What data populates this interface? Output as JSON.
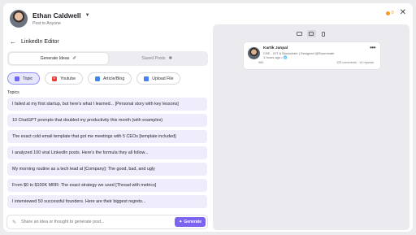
{
  "author": {
    "name": "Ethan Caldwell",
    "visibility": "Post to Anyone"
  },
  "editor": {
    "title": "LinkedIn Editor",
    "back_icon": "arrow-left-icon"
  },
  "tabs": {
    "generate": "Generate Ideas",
    "generate_glyph": "✐",
    "saved": "Saved Posts",
    "saved_glyph": "✱"
  },
  "sources": [
    {
      "label": "Topic",
      "icon": "topic-icon"
    },
    {
      "label": "Youtube",
      "icon": "youtube-icon"
    },
    {
      "label": "Article/Blog",
      "icon": "article-icon"
    },
    {
      "label": "Upload File",
      "icon": "upload-file-icon"
    }
  ],
  "topics_label": "Topics",
  "topics": [
    "I failed at my first startup, but here's what I learned... [Personal story with key lessons]",
    "10 ChatGPT prompts that doubled my productivity this month (with examples)",
    "The exact cold email template that got me meetings with 5 CEOs [template included]",
    "I analyzed 100 viral LinkedIn posts. Here's the formula they all follow...",
    "My morning routine as a tech lead at [Company]: The good, bad, and ugly",
    "From $0 to $100K MRR: The exact strategy we used [Thread with metrics]",
    "I interviewed 50 successful founders. Here are their biggest regrets..."
  ],
  "composer": {
    "placeholder": "Share an idea or thought to generate post...",
    "button": "Generate",
    "button_glyph": "✦"
  },
  "header": {
    "credits": "0"
  },
  "preview": {
    "name": "Kartik Janpal",
    "headline": "CSE - IOT & Blockchain | Designed @Roommate",
    "time": "1 hours ago • 🌐",
    "reactions": "980",
    "comments": "125 comments",
    "reposts": "14 reposts"
  },
  "colors": {
    "accent": "#7c63f2",
    "topic_bg": "#efedfc",
    "preview_bg": "#ebebef",
    "credits": "#f08c1d"
  }
}
